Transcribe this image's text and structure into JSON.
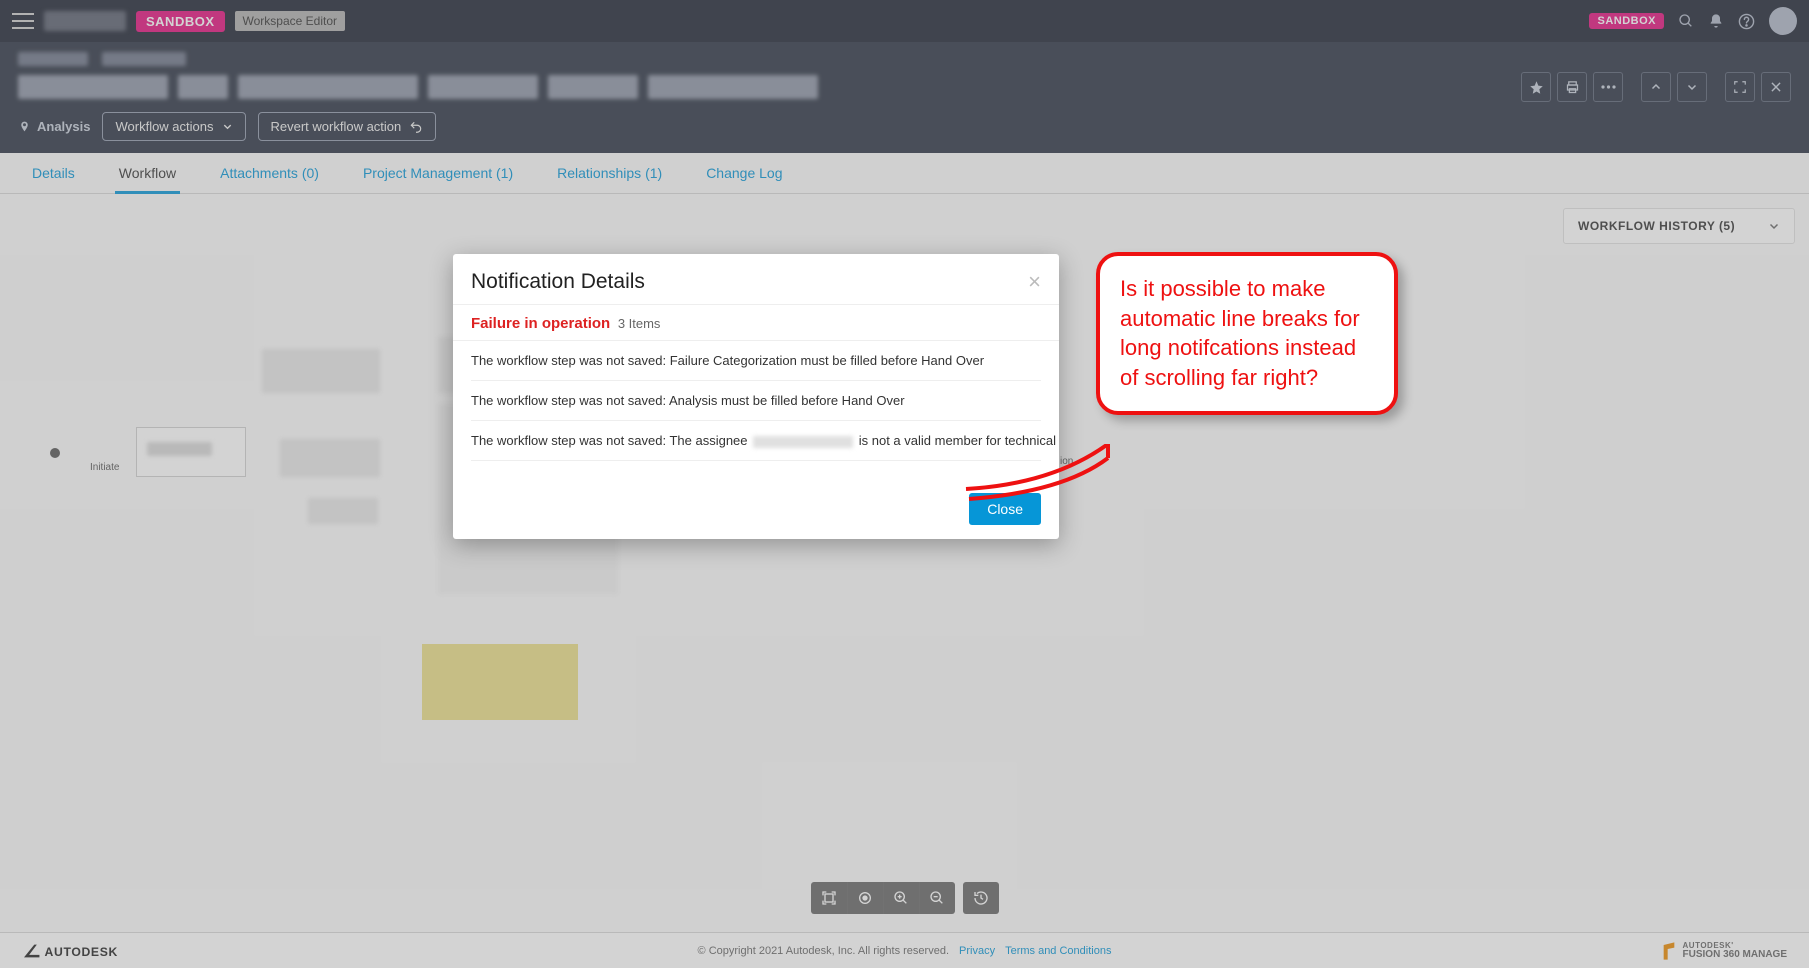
{
  "topbar": {
    "sandbox_badge": "SANDBOX",
    "workspace_badge": "Workspace Editor",
    "sandbox_badge_right": "SANDBOX"
  },
  "header": {
    "status_pin": "Analysis",
    "workflow_actions_btn": "Workflow actions",
    "revert_btn": "Revert workflow action"
  },
  "tabs": [
    {
      "label": "Details",
      "active": false
    },
    {
      "label": "Workflow",
      "active": true
    },
    {
      "label": "Attachments (0)",
      "active": false
    },
    {
      "label": "Project Management (1)",
      "active": false
    },
    {
      "label": "Relationships (1)",
      "active": false
    },
    {
      "label": "Change Log",
      "active": false
    }
  ],
  "history_panel": {
    "title": "WORKFLOW HISTORY (5)"
  },
  "workflow": {
    "initiate_label": "Initiate",
    "ion_label_fragment": "ion"
  },
  "modal": {
    "title": "Notification Details",
    "failure_label": "Failure in operation",
    "item_count": "3 Items",
    "rows": [
      {
        "pre": "The workflow step was not saved: Failure Categorization must be filled before Hand Over",
        "redact": false,
        "post": ""
      },
      {
        "pre": "The workflow step was not saved: Analysis must be filled before Hand Over",
        "redact": false,
        "post": ""
      },
      {
        "pre": "The workflow step was not saved: The assignee ",
        "redact": true,
        "post": " is not a valid member for technical review and cannot be assigned"
      }
    ],
    "close_btn": "Close"
  },
  "callout": {
    "text": "Is it possible to make automatic line breaks for long notifcations instead of scrolling far right?"
  },
  "footer": {
    "copyright": "© Copyright 2021 Autodesk, Inc. All rights reserved.",
    "privacy": "Privacy",
    "terms": "Terms and Conditions",
    "brand_top": "AUTODESK'",
    "brand_bottom": "FUSION 360  MANAGE"
  }
}
